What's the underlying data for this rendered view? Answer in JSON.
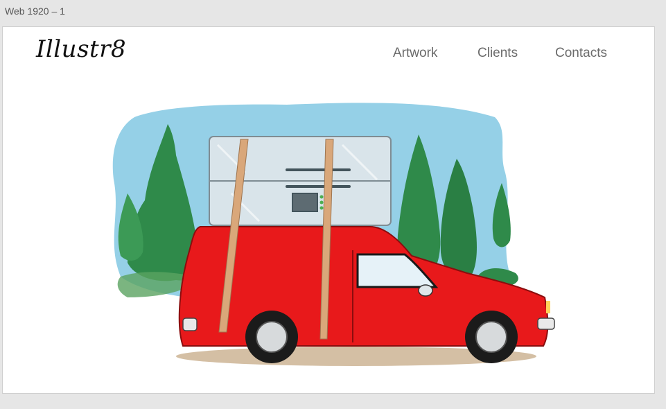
{
  "artboard": {
    "label": "Web 1920 – 1"
  },
  "header": {
    "logo_text": "Illustr8",
    "nav": [
      {
        "label": "Artwork"
      },
      {
        "label": "Clients"
      },
      {
        "label": "Contacts"
      }
    ]
  },
  "hero": {
    "subject": "illustration-red-van-carrying-refrigerator",
    "colors": {
      "sky": "#8fcde6",
      "tree": "#2f8a4a",
      "van": "#e8191b",
      "fridge": "#d9e4ea",
      "strap": "#d9a77a"
    }
  }
}
